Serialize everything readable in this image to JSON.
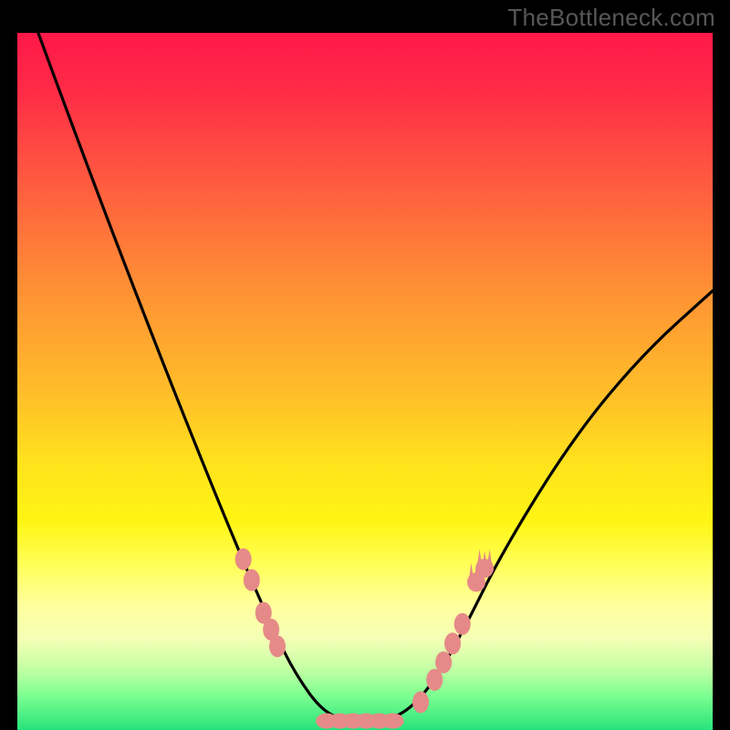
{
  "attribution": "TheBottleneck.com",
  "chart_data": {
    "type": "line",
    "title": "",
    "xlabel": "",
    "ylabel": "",
    "x_range": [
      0,
      100
    ],
    "y_range": [
      0,
      100
    ],
    "curve": {
      "name": "bottleneck-curve",
      "points_xy": [
        [
          3,
          100
        ],
        [
          10,
          81
        ],
        [
          20,
          55
        ],
        [
          28,
          35
        ],
        [
          33,
          23
        ],
        [
          37,
          14
        ],
        [
          40,
          8
        ],
        [
          44,
          2.5
        ],
        [
          48,
          1.2
        ],
        [
          52,
          1.2
        ],
        [
          56,
          2.5
        ],
        [
          60,
          7
        ],
        [
          64,
          14
        ],
        [
          70,
          26
        ],
        [
          80,
          42
        ],
        [
          90,
          54
        ],
        [
          100,
          63
        ]
      ]
    },
    "markers": {
      "color": "#e58a88",
      "left_cluster_xy": [
        [
          32.5,
          24.5
        ],
        [
          33.7,
          21.5
        ],
        [
          35.4,
          16.8
        ],
        [
          36.5,
          14.4
        ],
        [
          37.4,
          12.0
        ]
      ],
      "right_cluster_xy": [
        [
          58.0,
          4.0
        ],
        [
          60.0,
          7.2
        ],
        [
          61.3,
          9.7
        ],
        [
          62.6,
          12.4
        ],
        [
          64.0,
          15.2
        ],
        [
          66.0,
          21.2
        ],
        [
          67.2,
          23.2
        ]
      ],
      "right_cluster_spiky_indices_into_right_cluster": [
        5,
        6
      ],
      "valley_run_y": 1.3,
      "valley_run_x": [
        44.5,
        54.0
      ]
    },
    "background_gradient_stops": [
      {
        "pos": 0,
        "color": "#ff1848"
      },
      {
        "pos": 22,
        "color": "#ff5d3f"
      },
      {
        "pos": 52,
        "color": "#ffbf29"
      },
      {
        "pos": 76,
        "color": "#ffff55"
      },
      {
        "pos": 100,
        "color": "#27e37b"
      }
    ]
  }
}
